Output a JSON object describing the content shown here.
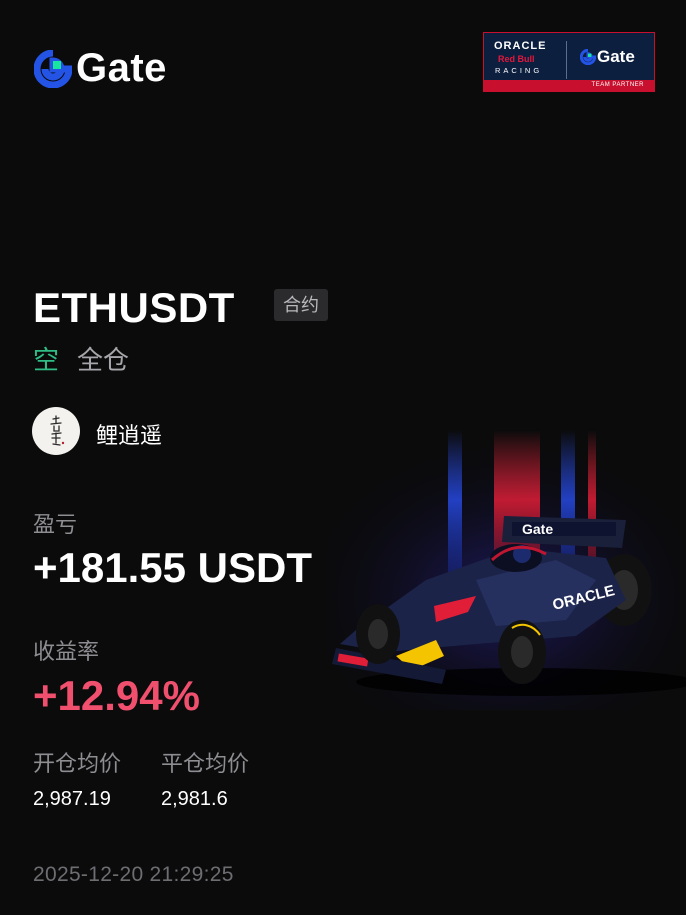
{
  "brand": {
    "name": "Gate"
  },
  "partner_badge": {
    "oracle": "ORACLE",
    "redbull": "Red Bull",
    "racing": "RACING",
    "gate": "Gate",
    "footer": "TEAM PARTNER"
  },
  "position": {
    "pair": "ETHUSDT",
    "contract_tag": "合约",
    "side": "空",
    "margin_mode": "全仓"
  },
  "user": {
    "name": "鲤逍遥"
  },
  "pnl": {
    "label": "盈亏",
    "value": "+181.55 USDT"
  },
  "roi": {
    "label": "收益率",
    "value": "+12.94%"
  },
  "prices": {
    "open_label": "开仓均价",
    "close_label": "平仓均价",
    "open_value": "2,987.19",
    "close_value": "2,981.6"
  },
  "timestamp": "2025-12-20 21:29:25",
  "colors": {
    "background": "#0b0b0c",
    "short_green": "#2fbd85",
    "roi_red": "#f0506e",
    "gate_blue": "#2354e6",
    "gate_green": "#17e6a1",
    "rb_red": "#c8102e",
    "rb_navy": "#0d1f3f"
  }
}
